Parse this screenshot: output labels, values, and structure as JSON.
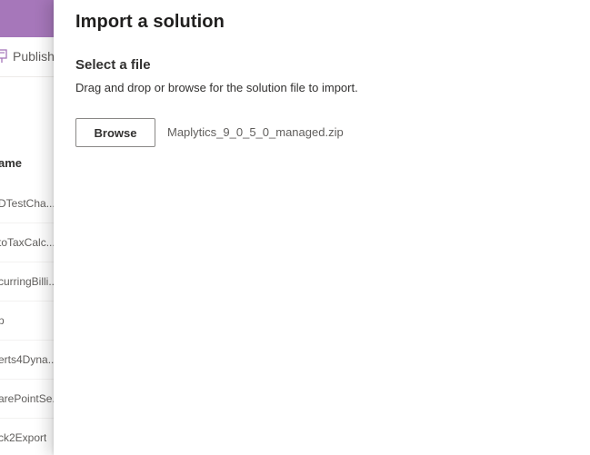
{
  "background": {
    "toolbar": {
      "publish_label": "Publish"
    },
    "list": {
      "column_header": "ame",
      "rows": [
        "DTestCha...",
        "toTaxCalc...",
        "curringBilli...",
        "p",
        "erts4Dyna...",
        "arePointSe...",
        "ck2Export"
      ]
    },
    "colors": {
      "header": "#a677ba"
    }
  },
  "panel": {
    "title": "Import a solution",
    "section_title": "Select a file",
    "description": "Drag and drop or browse for the solution file to import.",
    "browse_label": "Browse",
    "file_name": "Maplytics_9_0_5_0_managed.zip"
  }
}
